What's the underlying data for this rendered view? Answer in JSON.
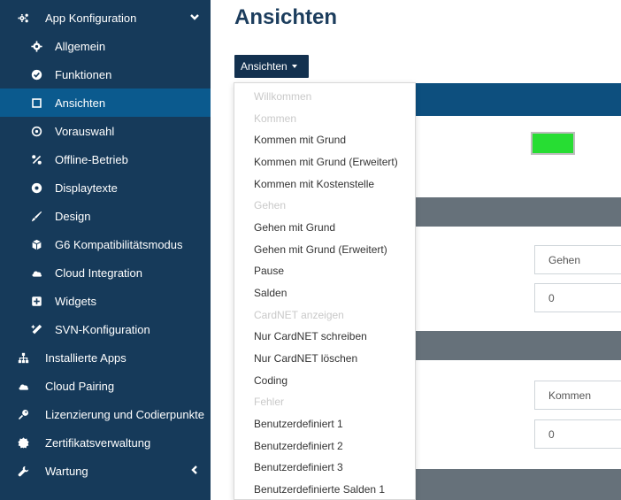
{
  "sidebar": {
    "header": {
      "label": "App Konfiguration",
      "icon": "cogs-icon"
    },
    "items": [
      {
        "label": "Allgemein",
        "icon": "gear-icon"
      },
      {
        "label": "Funktionen",
        "icon": "check-circle-icon"
      },
      {
        "label": "Ansichten",
        "icon": "square-outline-icon"
      },
      {
        "label": "Vorauswahl",
        "icon": "circle-dot-icon"
      },
      {
        "label": "Offline-Betrieb",
        "icon": "percent-icon"
      },
      {
        "label": "Displaytexte",
        "icon": "chat-circle-icon"
      },
      {
        "label": "Design",
        "icon": "brush-icon"
      },
      {
        "label": "G6 Kompatibilitätsmodus",
        "icon": "cube-icon"
      },
      {
        "label": "Cloud Integration",
        "icon": "cloud-icon"
      },
      {
        "label": "Widgets",
        "icon": "plus-square-icon"
      },
      {
        "label": "SVN-Konfiguration",
        "icon": "magic-icon"
      }
    ],
    "top_items": [
      {
        "label": "Installierte Apps",
        "icon": "sitemap-icon"
      },
      {
        "label": "Cloud Pairing",
        "icon": "cloud-icon"
      },
      {
        "label": "Lizenzierung und Codierpunkte",
        "icon": "key-icon"
      },
      {
        "label": "Zertifikatsverwaltung",
        "icon": "certificate-icon"
      },
      {
        "label": "Wartung",
        "icon": "wrench-icon"
      }
    ],
    "colors": {
      "background": "#163a5a",
      "active": "#0b5a8e"
    }
  },
  "main": {
    "title": "Ansichten",
    "dropdown_button": "Ansichten",
    "fields": {
      "value1": "Gehen",
      "value2": "0",
      "value3": "Kommen",
      "value4": "0"
    },
    "colors": {
      "color_swatch": "#27dd33",
      "section_header": "#0d4f7e",
      "section_gray": "#66717a"
    }
  },
  "dropdown": {
    "items": [
      {
        "label": "Willkommen",
        "disabled": true
      },
      {
        "label": "Kommen",
        "disabled": true
      },
      {
        "label": "Kommen mit Grund",
        "disabled": false
      },
      {
        "label": "Kommen mit Grund (Erweitert)",
        "disabled": false
      },
      {
        "label": "Kommen mit Kostenstelle",
        "disabled": false
      },
      {
        "label": "Gehen",
        "disabled": true
      },
      {
        "label": "Gehen mit Grund",
        "disabled": false
      },
      {
        "label": "Gehen mit Grund (Erweitert)",
        "disabled": false
      },
      {
        "label": "Pause",
        "disabled": false
      },
      {
        "label": "Salden",
        "disabled": false
      },
      {
        "label": "CardNET anzeigen",
        "disabled": true
      },
      {
        "label": "Nur CardNET schreiben",
        "disabled": false
      },
      {
        "label": "Nur CardNET löschen",
        "disabled": false
      },
      {
        "label": "Coding",
        "disabled": false
      },
      {
        "label": "Fehler",
        "disabled": true
      },
      {
        "label": "Benutzerdefiniert 1",
        "disabled": false
      },
      {
        "label": "Benutzerdefiniert 2",
        "disabled": false
      },
      {
        "label": "Benutzerdefiniert 3",
        "disabled": false
      },
      {
        "label": "Benutzerdefinierte Salden 1",
        "disabled": false
      }
    ]
  }
}
